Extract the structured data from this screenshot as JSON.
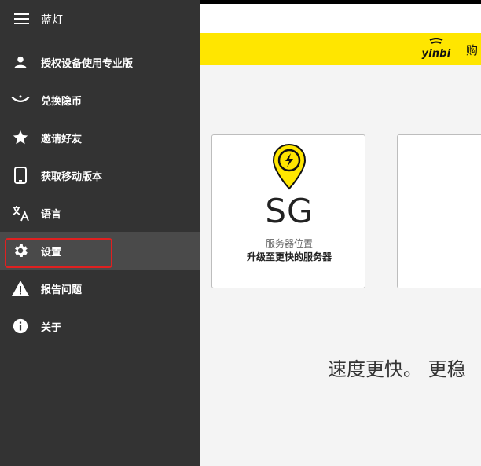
{
  "drawer": {
    "title": "蓝灯",
    "items": [
      {
        "label": "授权设备使用专业版",
        "icon": "person-icon"
      },
      {
        "label": "兑换隐币",
        "icon": "smile-icon"
      },
      {
        "label": "邀请好友",
        "icon": "star-icon"
      },
      {
        "label": "获取移动版本",
        "icon": "phone-icon"
      },
      {
        "label": "语言",
        "icon": "translate-icon"
      },
      {
        "label": "设置",
        "icon": "gear-icon",
        "active": true
      },
      {
        "label": "报告问题",
        "icon": "warning-icon"
      },
      {
        "label": "关于",
        "icon": "info-icon"
      }
    ]
  },
  "header": {
    "brand": "yinbi",
    "buy_text": "购"
  },
  "server_card": {
    "code": "SG",
    "location_label": "服务器位置",
    "upgrade_text": "升级至更快的服务器"
  },
  "slogan": "速度更快。 更稳",
  "colors": {
    "drawer_bg": "#333333",
    "active_item_bg": "#4a4a4a",
    "yellow": "#ffe600",
    "highlight": "#e02020"
  }
}
